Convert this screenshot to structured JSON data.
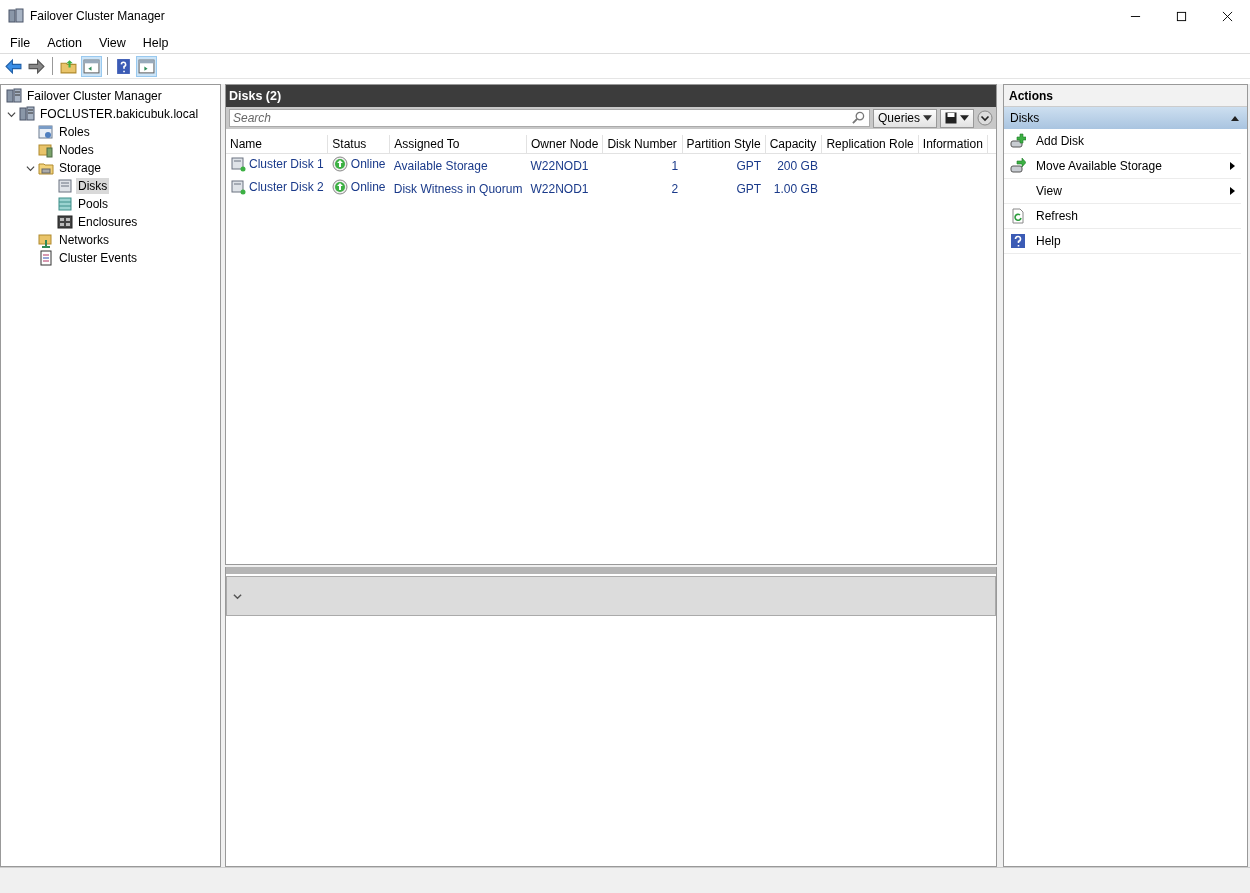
{
  "window": {
    "title": "Failover Cluster Manager"
  },
  "menu": [
    "File",
    "Action",
    "View",
    "Help"
  ],
  "tree": [
    {
      "label": "Failover Cluster Manager",
      "kind": "manager",
      "selected": false,
      "children": [
        {
          "label": "FOCLUSTER.bakicubuk.local",
          "kind": "cluster",
          "expanded": true,
          "selected": false,
          "children": [
            {
              "label": "Roles",
              "kind": "roles",
              "selected": false
            },
            {
              "label": "Nodes",
              "kind": "nodes",
              "selected": false
            },
            {
              "label": "Storage",
              "kind": "folder",
              "expanded": true,
              "selected": false,
              "children": [
                {
                  "label": "Disks",
                  "kind": "disk",
                  "selected": true
                },
                {
                  "label": "Pools",
                  "kind": "pool",
                  "selected": false
                },
                {
                  "label": "Enclosures",
                  "kind": "enclosure",
                  "selected": false
                }
              ]
            },
            {
              "label": "Networks",
              "kind": "network",
              "selected": false
            },
            {
              "label": "Cluster Events",
              "kind": "events",
              "selected": false
            }
          ]
        }
      ]
    }
  ],
  "center": {
    "title": "Disks (2)",
    "search": {
      "placeholder": "Search"
    },
    "queries": "Queries",
    "columns": [
      "Name",
      "Status",
      "Assigned To",
      "Owner Node",
      "Disk Number",
      "Partition Style",
      "Capacity",
      "Replication Role",
      "Information"
    ],
    "rows": [
      {
        "name": "Cluster Disk 1",
        "status": "Online",
        "assigned": "Available Storage",
        "owner": "W22NOD1",
        "disk_number": "1",
        "partition": "GPT",
        "capacity": "200 GB"
      },
      {
        "name": "Cluster Disk 2",
        "status": "Online",
        "assigned": "Disk Witness in Quorum",
        "owner": "W22NOD1",
        "disk_number": "2",
        "partition": "GPT",
        "capacity": "1.00 GB"
      }
    ],
    "details_expanded": false
  },
  "actions": {
    "title": "Actions",
    "section": {
      "label": "Disks",
      "expanded": true
    },
    "items": [
      {
        "label": "Add Disk",
        "kind": "add",
        "submenu": false
      },
      {
        "label": "Move Available Storage",
        "kind": "move",
        "submenu": true
      },
      {
        "label": "View",
        "kind": "plain",
        "submenu": true
      },
      {
        "label": "Refresh",
        "kind": "refresh",
        "submenu": false
      },
      {
        "label": "Help",
        "kind": "help",
        "submenu": false
      }
    ]
  }
}
